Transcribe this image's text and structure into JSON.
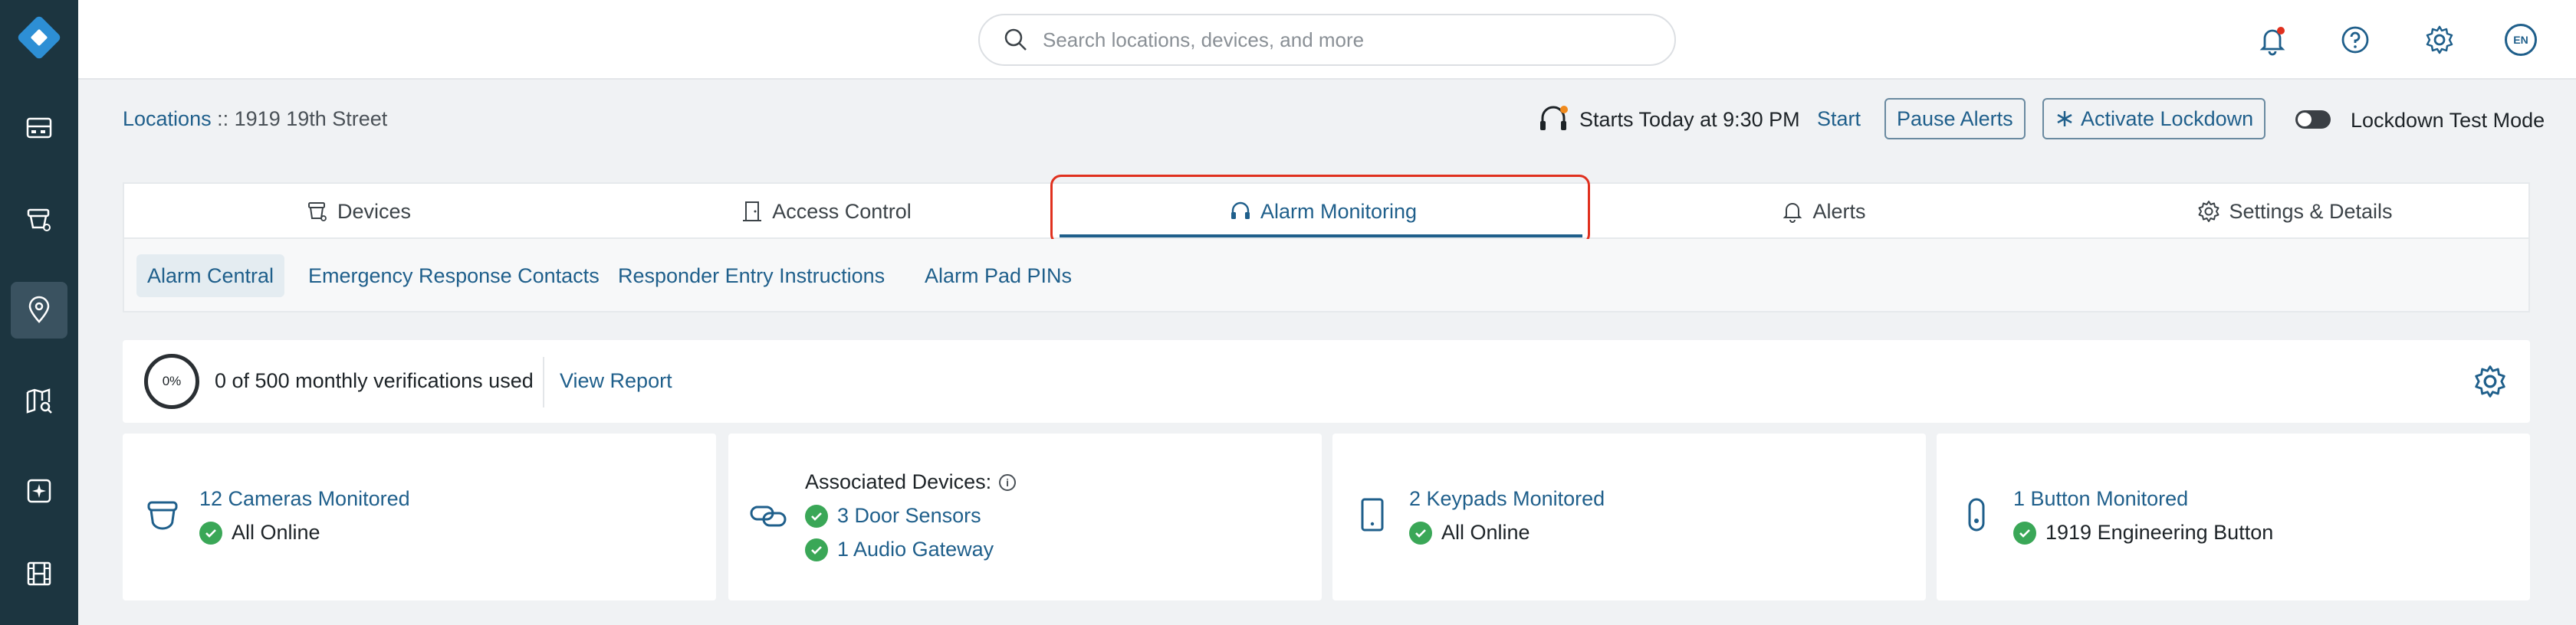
{
  "search": {
    "placeholder": "Search locations, devices, and more"
  },
  "header": {
    "lang": "EN"
  },
  "breadcrumb": {
    "parent": "Locations",
    "separator": "::",
    "current": "1919 19th Street"
  },
  "status_bar": {
    "alarm_schedule": "Starts Today at 9:30 PM",
    "start_label": "Start",
    "pause_alerts_label": "Pause Alerts",
    "activate_lockdown_label": "Activate Lockdown",
    "lockdown_test_mode_label": "Lockdown Test Mode"
  },
  "tabs": [
    {
      "label": "Devices",
      "icon": "devices-icon"
    },
    {
      "label": "Access Control",
      "icon": "door-icon"
    },
    {
      "label": "Alarm Monitoring",
      "icon": "headset-icon"
    },
    {
      "label": "Alerts",
      "icon": "bell-icon"
    },
    {
      "label": "Settings & Details",
      "icon": "gear-icon"
    }
  ],
  "subtabs": [
    {
      "label": "Alarm Central"
    },
    {
      "label": "Emergency Response Contacts"
    },
    {
      "label": "Responder Entry Instructions"
    },
    {
      "label": "Alarm Pad PINs"
    }
  ],
  "verifications": {
    "percent": "0%",
    "text": "0 of 500 monthly verifications used",
    "view_report": "View Report"
  },
  "cards": {
    "cameras": {
      "title": "12 Cameras Monitored",
      "status": "All Online"
    },
    "associated": {
      "title": "Associated Devices:",
      "door_sensors": "3 Door Sensors",
      "audio_gateway": "1 Audio Gateway"
    },
    "keypads": {
      "title": "2 Keypads Monitored",
      "status": "All Online"
    },
    "buttons": {
      "title": "1 Button Monitored",
      "status": "1919 Engineering Button"
    }
  },
  "colors": {
    "sidebar": "#1c3540",
    "accent": "#1f5f8b",
    "highlight": "#e0301e",
    "success": "#3aa757"
  }
}
